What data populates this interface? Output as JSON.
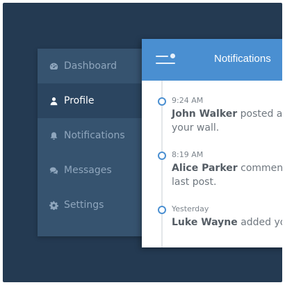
{
  "sidebar": {
    "items": [
      {
        "label": "Dashboard",
        "icon": "dashboard-icon",
        "active": false
      },
      {
        "label": "Profile",
        "icon": "user-icon",
        "active": true
      },
      {
        "label": "Notifications",
        "icon": "bell-icon",
        "active": false
      },
      {
        "label": "Messages",
        "icon": "comments-icon",
        "active": false
      },
      {
        "label": "Settings",
        "icon": "gear-icon",
        "active": false
      }
    ]
  },
  "panel": {
    "title": "Notifications",
    "menu_icon": "menu-icon",
    "notifications": [
      {
        "time": "9:24 AM",
        "name": "John Walker",
        "text": "posted a p",
        "text2": "your wall."
      },
      {
        "time": "8:19 AM",
        "name": "Alice Parker",
        "text": "comment",
        "text2": "last post."
      },
      {
        "time": "Yesterday",
        "name": "Luke Wayne",
        "text": "added yo",
        "text2": ""
      }
    ]
  },
  "colors": {
    "background": "#243a52",
    "sidebar": "#36536f",
    "sidebar_active": "#2b4560",
    "header": "#4a8fd1"
  }
}
